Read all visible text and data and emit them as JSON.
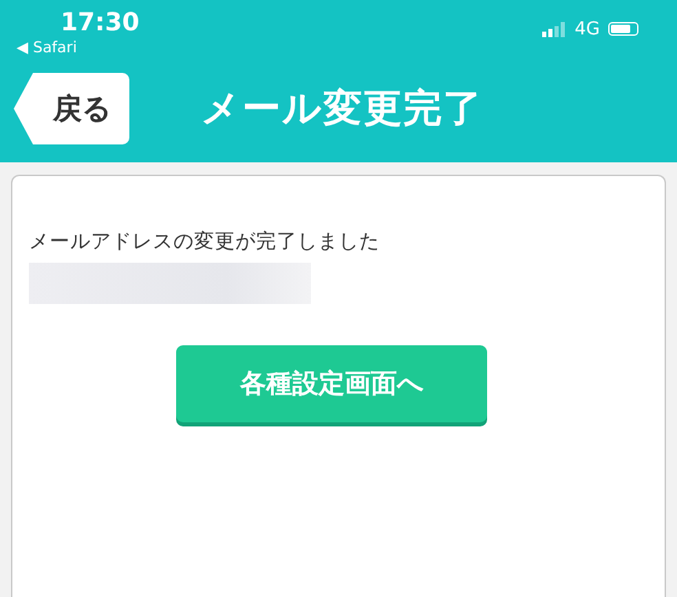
{
  "status_bar": {
    "time": "17:30",
    "back_app": "◀ Safari",
    "network": "4G"
  },
  "header": {
    "back_button": "戻る",
    "title": "メール変更完了"
  },
  "content": {
    "message": "メールアドレスの変更が完了しました",
    "button": "各種設定画面へ"
  }
}
